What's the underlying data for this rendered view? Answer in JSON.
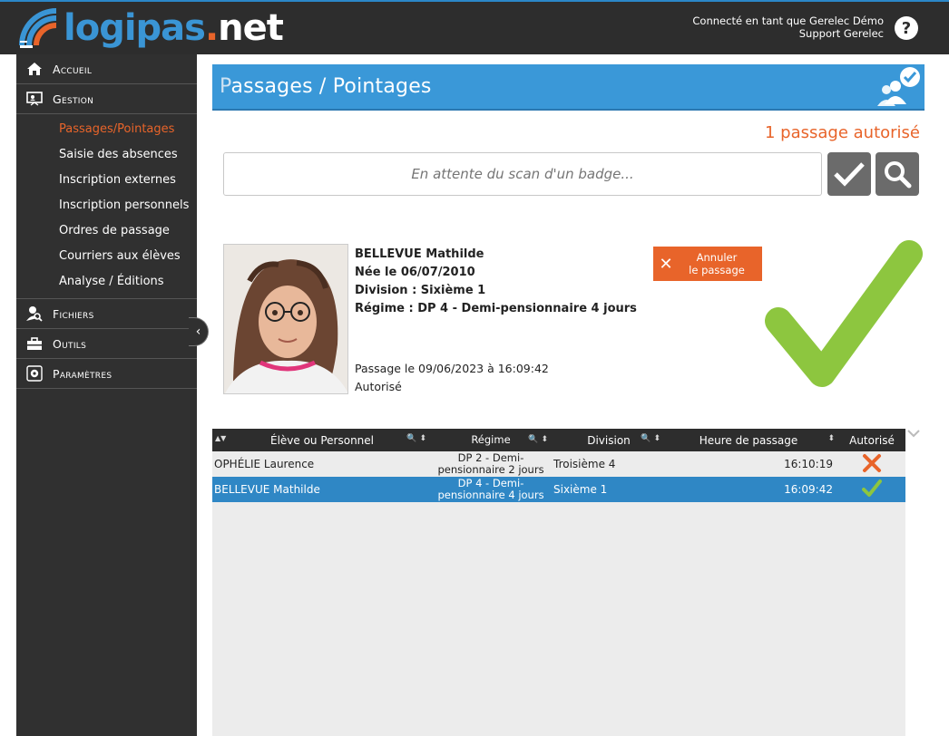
{
  "header": {
    "logo_main": "logipas",
    "logo_dot": ".",
    "logo_tld": "net",
    "user_line1": "Connecté en tant que Gerelec Démo",
    "user_line2": "Support Gerelec",
    "help_label": "?"
  },
  "sidebar": {
    "items": [
      {
        "label": "Accueil",
        "icon": "home-icon"
      },
      {
        "label": "Gestion",
        "icon": "presentation-icon"
      },
      {
        "label": "Fichiers",
        "icon": "user-search-icon"
      },
      {
        "label": "Outils",
        "icon": "toolbox-icon"
      },
      {
        "label": "Paramètres",
        "icon": "gear-icon"
      }
    ],
    "gestion_sub": [
      {
        "label": "Passages/Pointages",
        "active": true
      },
      {
        "label": "Saisie des absences"
      },
      {
        "label": "Inscription externes"
      },
      {
        "label": "Inscription personnels"
      },
      {
        "label": "Ordres de passage"
      },
      {
        "label": "Courriers aux élèves"
      },
      {
        "label": "Analyse / Éditions"
      }
    ],
    "collapse_icon": "‹"
  },
  "page": {
    "title_first": "P",
    "title_rest": "assages / Pointages",
    "count": "1 passage autorisé",
    "scan_placeholder": "En attente du scan d'un badge..."
  },
  "person": {
    "name": "BELLEVUE Mathilde",
    "birth": "Née le 06/07/2010",
    "division": "Division : Sixième 1",
    "regime": "Régime : DP 4 - Demi-pensionnaire 4 jours",
    "passage": "Passage le 09/06/2023 à 16:09:42",
    "status": "Autorisé",
    "cancel_line1": "Annuler",
    "cancel_line2": "le passage"
  },
  "table": {
    "columns": [
      "Élève ou Personnel",
      "Régime",
      "Division",
      "Heure de passage",
      "Autorisé"
    ],
    "rows": [
      {
        "name": "OPHÉLIE Laurence",
        "regime_l1": "DP 2 - Demi-",
        "regime_l2": "pensionnaire 2 jours",
        "division": "Troisième 4",
        "time": "16:10:19",
        "authorized": false
      },
      {
        "name": "BELLEVUE Mathilde",
        "regime_l1": "DP 4 - Demi-",
        "regime_l2": "pensionnaire 4 jours",
        "division": "Sixième 1",
        "time": "16:09:42",
        "authorized": true
      }
    ]
  },
  "colors": {
    "accent_blue": "#3a98d8",
    "accent_orange": "#e8642a",
    "sidebar_bg": "#303030",
    "check_green": "#8dc63f",
    "selected_row": "#2f87c5"
  }
}
